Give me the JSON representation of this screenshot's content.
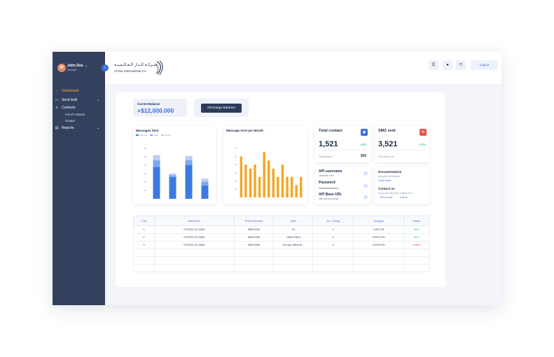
{
  "user": {
    "name": "John Doe",
    "role": "Manager"
  },
  "sidebar": {
    "items": [
      {
        "label": "Dashboard",
        "icon": "home-icon",
        "active": true
      },
      {
        "label": "Send bulk",
        "icon": "message-icon",
        "expandable": true
      },
      {
        "label": "Contacts",
        "icon": "user-icon"
      },
      {
        "label": "Reports",
        "icon": "document-icon",
        "expandable": true
      }
    ],
    "contacts_sub": [
      "List of contacts",
      "Groups"
    ]
  },
  "brand": {
    "arabic": "شـركـة الـدار الـعـالـمـيـة",
    "english": "Al Dar International Co."
  },
  "topbar": {
    "currency_icon": "currency-icon",
    "user_icon": "user-icon",
    "cart_icon": "cart-icon",
    "logout_label": "Logout"
  },
  "balance": {
    "label": "Current Balance",
    "value": "+$12,000.000",
    "recharge_label": "Recharge Balance"
  },
  "messages_sent": {
    "title": "Messages Sent",
    "legend": [
      "Delivered",
      "Failed",
      "Pending"
    ]
  },
  "per_month": {
    "title": "Message Sent per Month"
  },
  "total_contact": {
    "title": "Total contact",
    "value": "1,521",
    "change": "+35%",
    "period": "Yesterday",
    "period_value": "300",
    "badge_icon": "contacts-icon"
  },
  "sms_sent": {
    "title": "SMS sent",
    "value": "3,521",
    "change": "+35%",
    "period": "This Month",
    "period_value": "",
    "badge_icon": "sms-icon"
  },
  "api": {
    "username_label": "API username",
    "username_value": "username here",
    "password_label": "Password",
    "password_value": "••••••••••••••••••••",
    "baseurl_label": "API Base URL",
    "baseurl_value": "http://api.sms.sa/api"
  },
  "docs": {
    "title": "Documentation",
    "desc": "api guide and features",
    "link": "Learn More →",
    "contact_title": "Contact us",
    "contact_desc": "If you need any help, contact us at",
    "contact_link_1": "Send email",
    "contact_link_2": "Call us"
  },
  "table": {
    "headers": [
      "S.No",
      "Date/Time",
      "Phone Number",
      "SMS",
      "No. of Msg",
      "Charges",
      "Status"
    ],
    "rows": [
      [
        "1",
        "07/2022 10:15AM",
        "966XX254",
        "Hi",
        "1",
        "0.001 KD",
        "Sent"
      ],
      [
        "2",
        "07/2022 10:15AM",
        "966XX254",
        "Hello Client",
        "2",
        "0.0012 KD",
        "Sent"
      ],
      [
        "3",
        "07/2022 10:15AM",
        "966XX254",
        "Our top offers th...",
        "2",
        "0.0015 KD",
        "Failed"
      ],
      [
        "",
        "",
        "",
        "",
        "",
        "",
        ""
      ],
      [
        "",
        "",
        "",
        "",
        "",
        "",
        ""
      ],
      [
        "",
        "",
        "",
        "",
        "",
        "",
        ""
      ]
    ]
  },
  "colors": {
    "sidebar": "#33415f",
    "accent": "#3b6fd9",
    "orange": "#f5a623",
    "green": "#2ec27e",
    "red": "#e8534d"
  },
  "chart_data": [
    {
      "type": "bar",
      "title": "Messages Sent",
      "categories": [
        "",
        "",
        "",
        ""
      ],
      "series": [
        {
          "name": "Delivered",
          "values": [
            38,
            26,
            40,
            16
          ]
        },
        {
          "name": "Failed",
          "values": [
            8,
            2,
            6,
            4
          ]
        },
        {
          "name": "Pending",
          "values": [
            6,
            2,
            5,
            4
          ]
        }
      ],
      "stacked": true,
      "ylim": [
        0,
        70
      ],
      "yticks": [
        10,
        20,
        30,
        40,
        50,
        60
      ]
    },
    {
      "type": "bar",
      "title": "Message Sent per Month",
      "categories": [
        "",
        "",
        "",
        "",
        "",
        "",
        "",
        "",
        "",
        "",
        "",
        "",
        "",
        ""
      ],
      "values": [
        50,
        40,
        35,
        40,
        25,
        55,
        45,
        35,
        25,
        40,
        25,
        25,
        15,
        25
      ],
      "ylim": [
        0,
        70
      ],
      "yticks": [
        10,
        20,
        30,
        40,
        50,
        60
      ]
    }
  ]
}
